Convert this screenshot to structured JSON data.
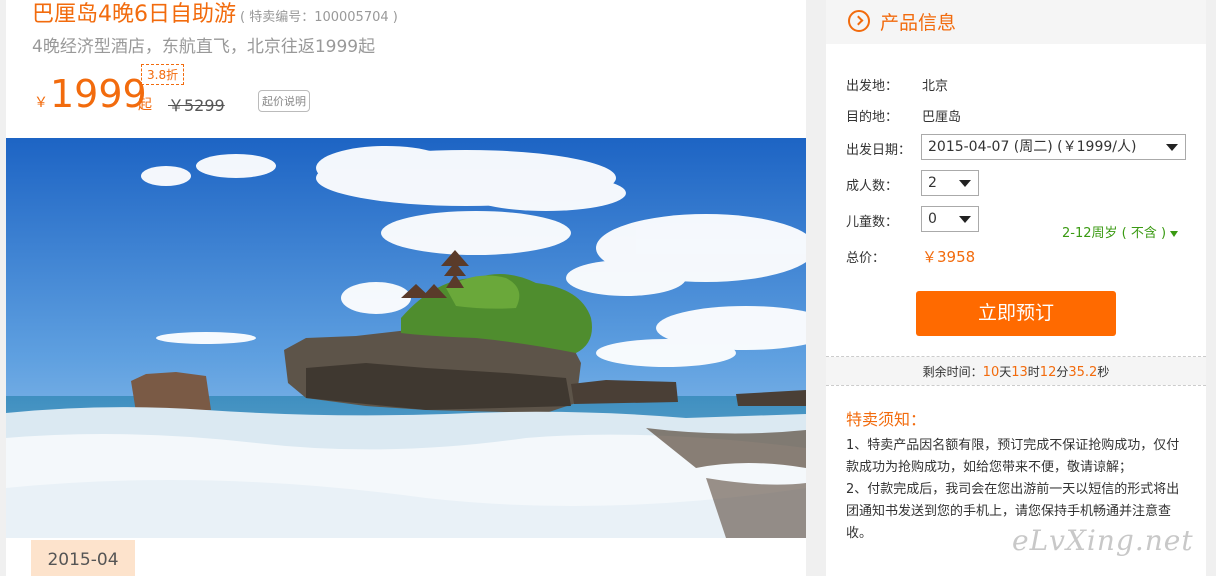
{
  "product": {
    "title": "巴厘岛4晚6日自助游",
    "code_text": "( 特卖编号：100005704 )",
    "subtitle": "4晚经济型酒店，东航直飞，北京往返1999起",
    "currency": "￥",
    "price": "1999",
    "price_suffix": "起",
    "discount": "3.8折",
    "original_price": "￥5299",
    "price_explain": "起价说明"
  },
  "calendar": {
    "month_tab": "2015-04"
  },
  "info_panel": {
    "title": "产品信息",
    "depart_label": "出发地：",
    "depart_value": "北京",
    "dest_label": "目的地：",
    "dest_value": "巴厘岛",
    "date_label": "出发日期：",
    "date_value": "2015-04-07 (周二) (￥1999/人)",
    "adults_label": "成人数：",
    "adults_value": "2",
    "children_label": "儿童数：",
    "children_value": "0",
    "children_age_note": "2-12周岁 ( 不含 )",
    "total_label": "总价：",
    "total_value": "￥3958",
    "book_button": "立即预订"
  },
  "countdown": {
    "label": "剩余时间：",
    "days": "10",
    "days_unit": "天",
    "hours": "13",
    "hours_unit": "时",
    "minutes": "12",
    "minutes_unit": "分",
    "seconds": "35.2",
    "seconds_unit": "秒"
  },
  "notice": {
    "title": "特卖须知：",
    "line1": "1、特卖产品因名额有限，预订完成不保证抢购成功，仅付款成功为抢购成功，如给您带来不便，敬请谅解；",
    "line2": "2、付款完成后，我司会在您出游前一天以短信的形式将出团通知书发送到您的手机上，请您保持手机畅通并注意查收。"
  },
  "watermark": "eLvXing.net",
  "colors": {
    "accent": "#f26b0d",
    "button": "#ff6a00",
    "green": "#3a9a12"
  }
}
